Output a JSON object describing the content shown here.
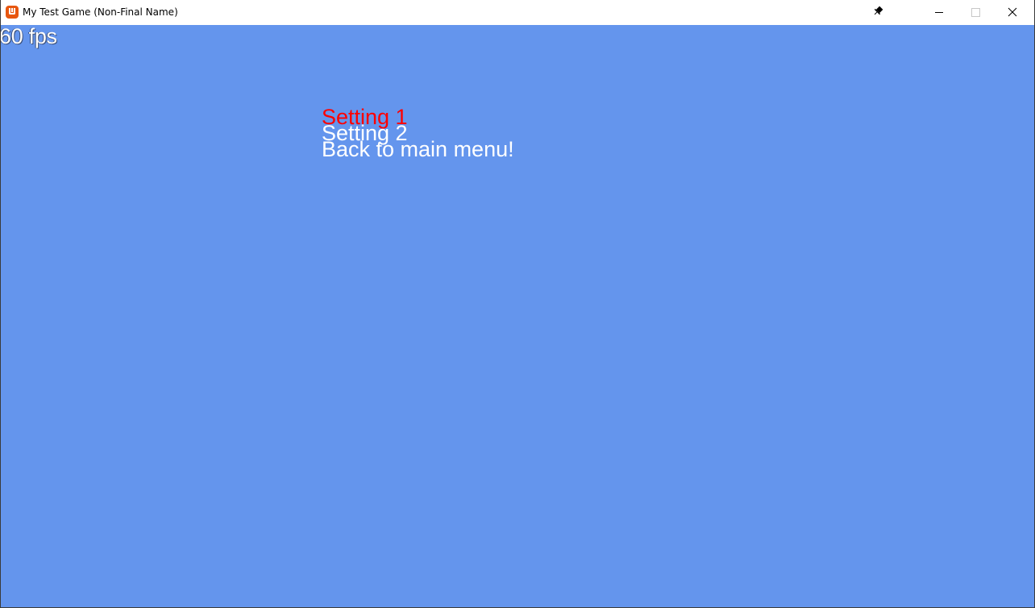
{
  "window": {
    "title": "My Test Game (Non-Final Name)",
    "icon": "monogame-app-icon",
    "controls": [
      "pin-icon",
      "minimize-icon",
      "maximize-icon",
      "close-icon"
    ]
  },
  "hud": {
    "fps_label": "60 fps"
  },
  "settings_menu": {
    "selected_index": 0,
    "selected_color": "#ff0000",
    "default_color": "#ffffff",
    "items": [
      {
        "label": "Setting 1"
      },
      {
        "label": "Setting 2"
      },
      {
        "label": "Back to main menu!"
      }
    ]
  },
  "colors": {
    "viewport_background": "#6495ed",
    "titlebar_background": "#ffffff",
    "app_icon": "#e7560f"
  }
}
